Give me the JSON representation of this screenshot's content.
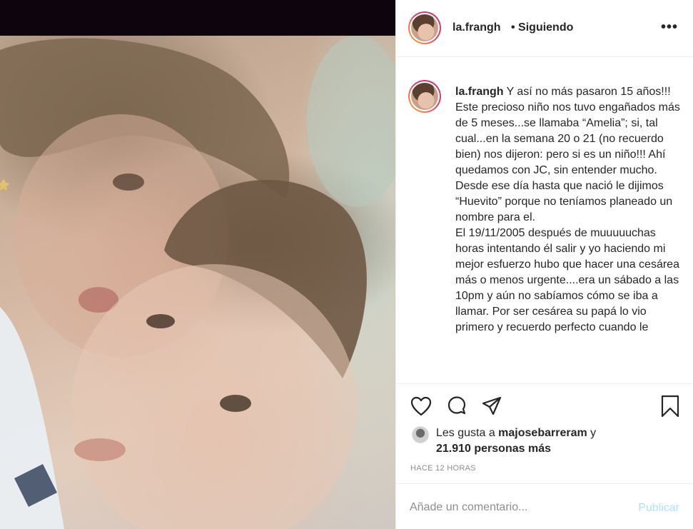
{
  "post": {
    "username": "la.frangh",
    "follow_status": "• Siguiendo",
    "more_icon": "more-options-icon",
    "caption_lines": [
      "Y así no más pasaron 15 años!!!",
      "Este precioso niño nos tuvo engañados más de 5 meses...se llamaba “Amelia”; si, tal cual...en la semana 20 o 21 (no recuerdo bien) nos dijeron: pero si es un niño!!! Ahí quedamos con JC, sin entender mucho. Desde ese día hasta que nació le dijimos “Huevito” porque no teníamos planeado un nombre para el.",
      "El 19/11/2005 después de muuuuuchas horas intentando él salir y yo haciendo mi mejor esfuerzo hubo que hacer una cesárea más o menos urgente....era un sábado a las 10pm y aún no sabíamos cómo se iba a llamar. Por ser cesárea su papá lo vio primero y recuerdo perfecto cuando le"
    ]
  },
  "actions": {
    "like_icon": "heart-icon",
    "comment_icon": "comment-icon",
    "share_icon": "paper-plane-icon",
    "save_icon": "bookmark-icon"
  },
  "likes": {
    "prefix": "Les gusta a ",
    "user": "majosebarreram",
    "joiner": " y",
    "count_text": "21.910 personas más"
  },
  "time_ago": "HACE 12 HORAS",
  "comment": {
    "placeholder": "Añade un comentario...",
    "publish_label": "Publicar"
  },
  "colors": {
    "publish_disabled": "#b2dffc",
    "muted": "#8e8e8e",
    "text": "#262626"
  }
}
